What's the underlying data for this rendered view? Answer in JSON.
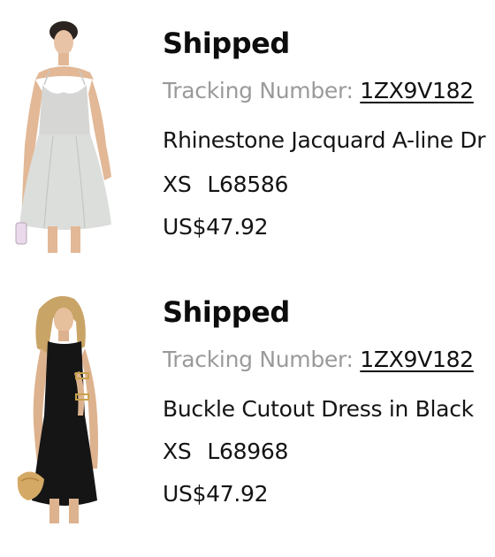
{
  "orders": [
    {
      "status": "Shipped",
      "tracking_label": "Tracking Number:",
      "tracking_number": "1ZX9V182",
      "product_name": "Rhinestone Jacquard A-line Dr",
      "size": "XS",
      "sku": "L68586",
      "price": "US$47.92",
      "image": "light-grey-a-line-mini-dress"
    },
    {
      "status": "Shipped",
      "tracking_label": "Tracking Number:",
      "tracking_number": "1ZX9V182",
      "product_name": "Buckle Cutout Dress in Black",
      "size": "XS",
      "sku": "L68968",
      "price": "US$47.92",
      "image": "black-buckle-cutout-mini-dress"
    }
  ],
  "colors": {
    "status_text": "#0d0d0d",
    "tracking_label": "#9a9a9a",
    "body_text": "#141414",
    "background": "#ffffff"
  }
}
